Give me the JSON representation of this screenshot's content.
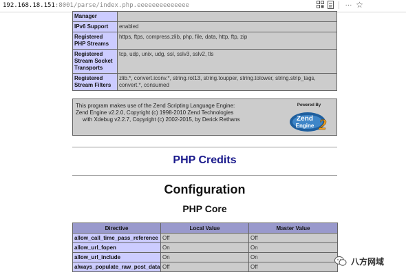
{
  "browser": {
    "url_host": "192.168.18.151",
    "url_port": ":8001",
    "url_path": "/parse/index.php.eeeeeeeeeeeeee",
    "icons": [
      "grid-icon",
      "reader-icon",
      "more-icon",
      "bookmark-star-icon"
    ],
    "more_glyph": "···",
    "star_glyph": "☆"
  },
  "streams_table": [
    {
      "label": "Manager",
      "value": ""
    },
    {
      "label": "IPv6 Support",
      "value": "enabled"
    },
    {
      "label": "Registered PHP Streams",
      "value": "https, ftps, compress.zlib, php, file, data, http, ftp, zip"
    },
    {
      "label": "Registered Stream Socket Transports",
      "value": "tcp, udp, unix, udg, ssl, sslv3, sslv2, tls"
    },
    {
      "label": "Registered Stream Filters",
      "value": "zlib.*, convert.iconv.*, string.rot13, string.toupper, string.tolower, string.strip_tags, convert.*, consumed"
    }
  ],
  "zend": {
    "line1": "This program makes use of the Zend Scripting Language Engine:",
    "line2": "Zend Engine v2.2.0, Copyright (c) 1998-2010 Zend Technologies",
    "line3": "with Xdebug v2.2.7, Copyright (c) 2002-2015, by Derick Rethans",
    "logo_powered": "Powered By",
    "logo_word1": "Zend",
    "logo_word2": "Engine",
    "logo_num": "2"
  },
  "headings": {
    "credits": "PHP Credits",
    "configuration": "Configuration",
    "core": "PHP Core"
  },
  "config_table": {
    "headers": [
      "Directive",
      "Local Value",
      "Master Value"
    ],
    "rows": [
      [
        "allow_call_time_pass_reference",
        "Off",
        "Off"
      ],
      [
        "allow_url_fopen",
        "On",
        "On"
      ],
      [
        "allow_url_include",
        "On",
        "On"
      ],
      [
        "always_populate_raw_post_data",
        "Off",
        "Off"
      ]
    ]
  },
  "watermark": {
    "text": "八方网域"
  },
  "colors": {
    "header_blue": "#9999cc",
    "label_blue": "#ccccff",
    "value_gray": "#cccccc",
    "credits_blue": "#1a1a8c"
  }
}
